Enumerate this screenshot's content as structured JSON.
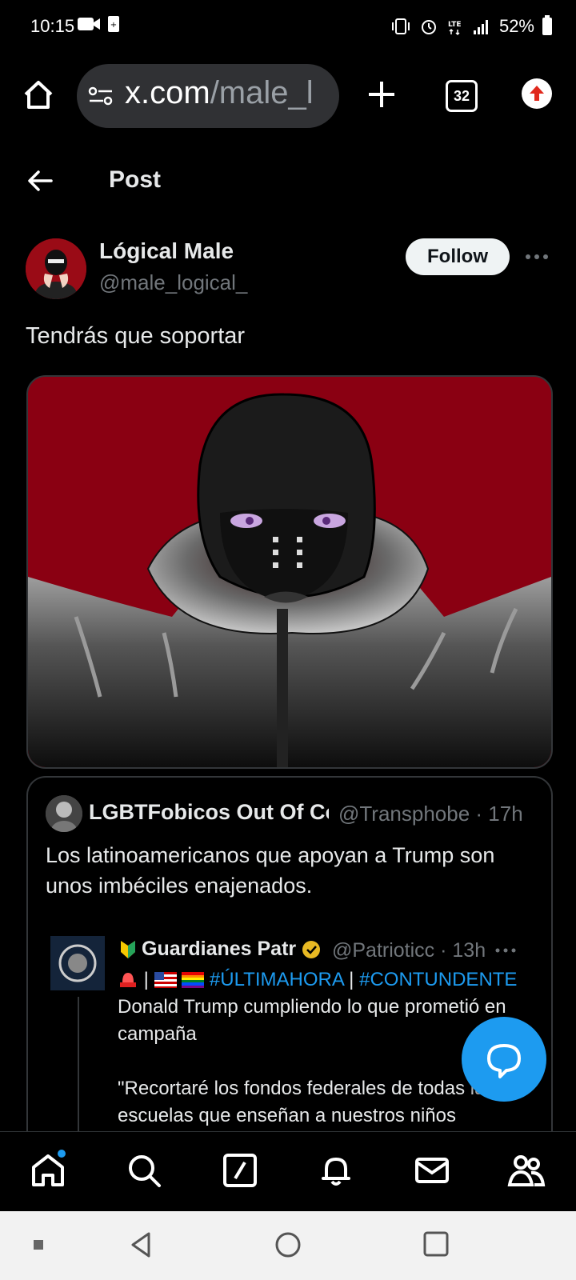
{
  "status_bar": {
    "time": "10:15",
    "battery": "52%"
  },
  "browser": {
    "url_host": "x.com",
    "url_path": "/male_l",
    "tab_count": "32"
  },
  "header": {
    "title": "Post"
  },
  "post": {
    "author_name": "Lógical Male",
    "author_handle": "@male_logical_",
    "follow_label": "Follow",
    "text": "Tendrás que soportar"
  },
  "quote": {
    "author_name": "LGBTFobicos Out Of Co",
    "author_handle": "@Transphobe · 17h",
    "text": "Los latinoamericanos que apoyan a Trump son unos imbéciles enajenados.",
    "nested": {
      "author_name": "Guardianes Patr",
      "author_handle": "@Patrioticc · 13h",
      "hashtag1": "#ÚLTIMAHORA",
      "hashtag2": "#CONTUNDENTE",
      "sep": " | ",
      "body_after": " Donald Trump cumpliendo lo que prometió en campaña",
      "quote_text": "\"Recortaré los fondos federales de todas las escuelas que enseñan a nuestros niños"
    }
  },
  "colors": {
    "accent": "#1d9bf0",
    "background": "#000000",
    "image_red": "#8a0012"
  }
}
